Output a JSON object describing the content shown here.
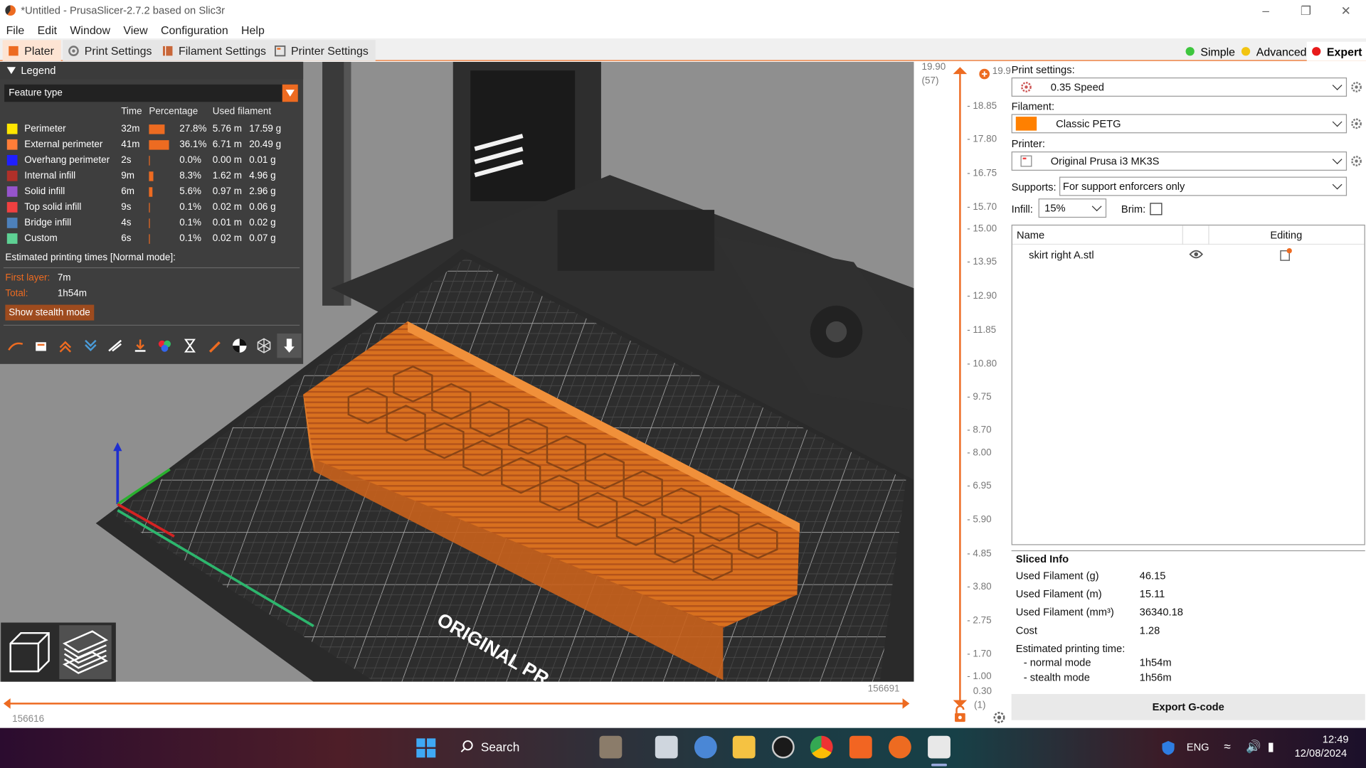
{
  "window": {
    "title": "*Untitled - PrusaSlicer-2.7.2 based on Slic3r"
  },
  "menu": [
    "File",
    "Edit",
    "Window",
    "View",
    "Configuration",
    "Help"
  ],
  "tabs": {
    "plater": "Plater",
    "print": "Print Settings",
    "filament": "Filament Settings",
    "printer": "Printer Settings"
  },
  "modes": {
    "simple": "Simple",
    "advanced": "Advanced",
    "expert": "Expert"
  },
  "colors": {
    "accent": "#ed6b21",
    "simple": "#3ec63e",
    "advanced": "#f2c410",
    "expert": "#e81a1a"
  },
  "legend": {
    "title": "Legend",
    "feature_select": "Feature type",
    "headers": {
      "time": "Time",
      "percentage": "Percentage",
      "used": "Used filament"
    },
    "rows": [
      {
        "name": "Perimeter",
        "color": "#ffe600",
        "time": "32m",
        "pct": "27.8%",
        "len": "5.76 m",
        "g": "17.59 g",
        "frac": 0.278
      },
      {
        "name": "External perimeter",
        "color": "#ff7d38",
        "time": "41m",
        "pct": "36.1%",
        "len": "6.71 m",
        "g": "20.49 g",
        "frac": 0.361
      },
      {
        "name": "Overhang perimeter",
        "color": "#1f1fff",
        "time": "2s",
        "pct": "0.0%",
        "len": "0.00 m",
        "g": "0.01 g",
        "frac": 0.0
      },
      {
        "name": "Internal infill",
        "color": "#b03029",
        "time": "9m",
        "pct": "8.3%",
        "len": "1.62 m",
        "g": "4.96 g",
        "frac": 0.083
      },
      {
        "name": "Solid infill",
        "color": "#9654cc",
        "time": "6m",
        "pct": "5.6%",
        "len": "0.97 m",
        "g": "2.96 g",
        "frac": 0.056
      },
      {
        "name": "Top solid infill",
        "color": "#f04040",
        "time": "9s",
        "pct": "0.1%",
        "len": "0.02 m",
        "g": "0.06 g",
        "frac": 0.001
      },
      {
        "name": "Bridge infill",
        "color": "#4d80ba",
        "time": "4s",
        "pct": "0.1%",
        "len": "0.01 m",
        "g": "0.02 g",
        "frac": 0.001
      },
      {
        "name": "Custom",
        "color": "#5ed194",
        "time": "6s",
        "pct": "0.1%",
        "len": "0.02 m",
        "g": "0.07 g",
        "frac": 0.001
      }
    ],
    "estimated": "Estimated printing times [Normal mode]:",
    "first_layer_label": "First layer:",
    "first_layer": "7m",
    "total_label": "Total:",
    "total": "1h54m",
    "stealth_button": "Show stealth mode"
  },
  "bed_text": "ORIGINAL PR",
  "vslider": {
    "top": "19.90",
    "top_sub": "(57)",
    "top_right": "19.90",
    "ticks": [
      "18.85",
      "17.80",
      "16.75",
      "15.70",
      "15.00",
      "13.95",
      "12.90",
      "11.85",
      "10.80",
      "9.75",
      "8.70",
      "8.00",
      "6.95",
      "5.90",
      "4.85",
      "3.80",
      "2.75",
      "1.70",
      "1.00"
    ],
    "bottom": "0.30",
    "bottom_sub": "(1)"
  },
  "hslider": {
    "left": "156616",
    "right": "156691"
  },
  "right_panel": {
    "print_label": "Print settings:",
    "print_value": "0.35 Speed",
    "filament_label": "Filament:",
    "filament_value": "Classic PETG",
    "filament_color": "#ff8000",
    "printer_label": "Printer:",
    "printer_value": "Original Prusa i3 MK3S",
    "supports_label": "Supports:",
    "supports_value": "For support enforcers only",
    "infill_label": "Infill:",
    "infill_value": "15%",
    "brim_label": "Brim:",
    "list_name_header": "Name",
    "list_editing_header": "Editing",
    "object_name": "skirt right A.stl"
  },
  "sliced_info": {
    "title": "Sliced Info",
    "rows": [
      {
        "label": "Used Filament (g)",
        "value": "46.15"
      },
      {
        "label": "Used Filament (m)",
        "value": "15.11"
      },
      {
        "label": "Used Filament (mm³)",
        "value": "36340.18"
      },
      {
        "label": "Cost",
        "value": "1.28"
      }
    ],
    "est_label": "Estimated printing time:",
    "normal_label": "- normal mode",
    "normal_value": "1h54m",
    "stealth_label": "- stealth mode",
    "stealth_value": "1h56m",
    "export_button": "Export G-code"
  },
  "taskbar": {
    "search": "Search",
    "lang": "ENG",
    "time": "12:49",
    "date": "12/08/2024"
  }
}
